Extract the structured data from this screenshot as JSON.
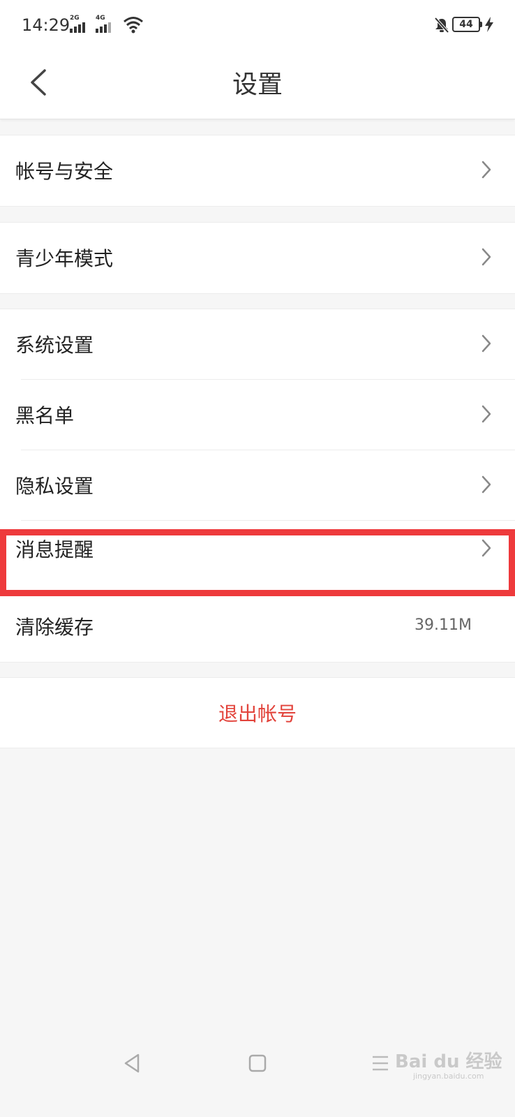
{
  "status_bar": {
    "time": "14:29",
    "sim1_tag": "2G",
    "sim2_tag": "4G",
    "battery": "44"
  },
  "header": {
    "title": "设置"
  },
  "settings": {
    "group1": [
      {
        "label": "帐号与安全"
      }
    ],
    "group2": [
      {
        "label": "青少年模式"
      }
    ],
    "group3": [
      {
        "label": "系统设置"
      },
      {
        "label": "黑名单"
      },
      {
        "label": "隐私设置"
      },
      {
        "label": "消息提醒"
      },
      {
        "label": "清除缓存",
        "value": "39.11M"
      }
    ]
  },
  "logout": {
    "label": "退出帐号"
  },
  "watermark": {
    "text": "Bai du 经验",
    "sub": "jingyan.baidu.com"
  },
  "colors": {
    "accent_red": "#e2433b",
    "highlight": "#ee3a3c",
    "background": "#f6f6f6"
  },
  "icons": [
    "back-icon",
    "chevron-right-icon",
    "wifi-icon",
    "bell-muted-icon",
    "charging-icon",
    "nav-back-icon",
    "nav-home-icon",
    "nav-menu-icon"
  ]
}
